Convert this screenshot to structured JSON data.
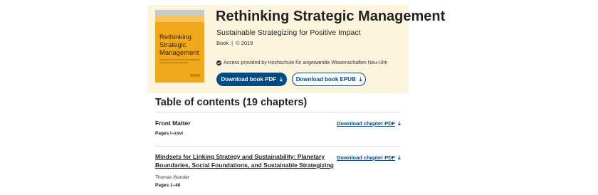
{
  "book": {
    "cover": {
      "title_lines": [
        "Rethinking",
        "Strategic",
        "Management"
      ],
      "color": "#f0a81d"
    },
    "title": "Rethinking Strategic Management",
    "subtitle": "Sustainable Strategizing for Positive Impact",
    "type": "Book",
    "separator": "|",
    "year": "© 2019",
    "access_text": "Access provided by Hochschule für angewandte Wissenschaften Neu-Ulm",
    "download_pdf_label": "Download book PDF",
    "download_epub_label": "Download book EPUB",
    "download_icon": "⤓"
  },
  "toc": {
    "heading": "Table of contents (19 chapters)",
    "items": [
      {
        "title": "Front Matter",
        "pages": "Pages i–xxvi",
        "download_label": "Download chapter PDF"
      },
      {
        "title_line1": "Mindsets for Linking Strategy and Sustainability: Planetary",
        "title_line2": "Boundaries, Social Foundations, and Sustainable Strategizing",
        "author": "Thomas Wunder",
        "pages": "Pages 1–40",
        "download_label": "Download chapter PDF"
      }
    ]
  },
  "colors": {
    "hero_bg": "#fcf4dc",
    "primary": "#004b83"
  },
  "icons": [
    "check-icon",
    "download-icon"
  ]
}
